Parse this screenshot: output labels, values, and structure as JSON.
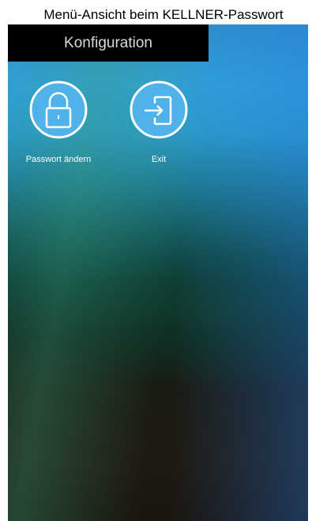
{
  "caption": "Menü-Ansicht beim KELLNER-Passwort",
  "header": {
    "title": "Konfiguration"
  },
  "menu": {
    "items": [
      {
        "label": "Passwort ändern",
        "icon": "lock-icon"
      },
      {
        "label": "Exit",
        "icon": "exit-door-icon"
      }
    ]
  },
  "colors": {
    "titlebar_bg": "#000000",
    "title_text": "#d9d9d9",
    "icon_circle": "#4fb3ea",
    "icon_stroke": "#ffffff"
  }
}
